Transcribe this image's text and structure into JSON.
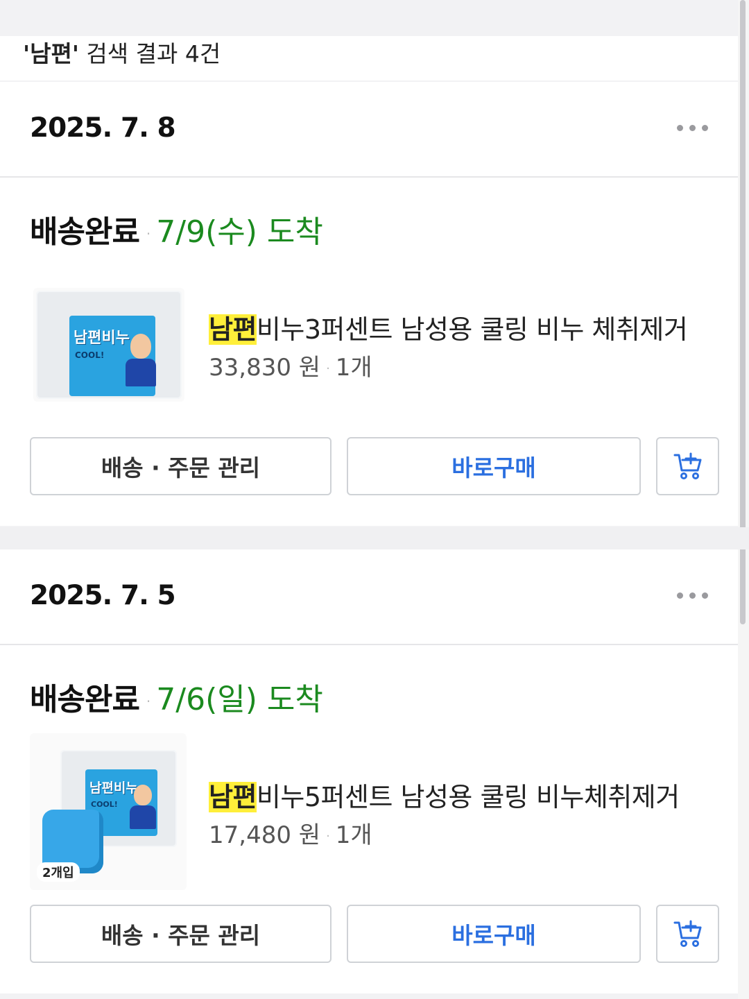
{
  "search": {
    "keyword": "'남편'",
    "result_text": " 검색 결과 4건"
  },
  "orders": [
    {
      "date": "2025. 7. 8",
      "status": "배송완료",
      "arrival": "7/9(수) 도착",
      "product": {
        "highlight": "남편",
        "title_rest": "비누3퍼센트 남성용 쿨링 비누 체취제거",
        "price": "33,830 원",
        "quantity": "1개",
        "image_label": "남편비누",
        "image_caption": "COOL!"
      },
      "buttons": {
        "manage": "배송 · 주문 관리",
        "buy": "바로구매"
      }
    },
    {
      "date": "2025. 7. 5",
      "status": "배송완료",
      "arrival": "7/6(일) 도착",
      "product": {
        "highlight": "남편",
        "title_rest": "비누5퍼센트 남성용 쿨링 비누체취제거",
        "price": "17,480 원",
        "quantity": "1개",
        "image_label": "남편비누",
        "image_caption": "COOL!",
        "image_count": "2개입"
      },
      "buttons": {
        "manage": "배송 · 주문 관리",
        "buy": "바로구매"
      }
    }
  ],
  "colors": {
    "arrival_green": "#1b8a1f",
    "buy_blue": "#2b6fe0",
    "highlight_yellow": "#ffef3a"
  },
  "icons": [
    "more-dots-icon",
    "cart-add-icon"
  ]
}
